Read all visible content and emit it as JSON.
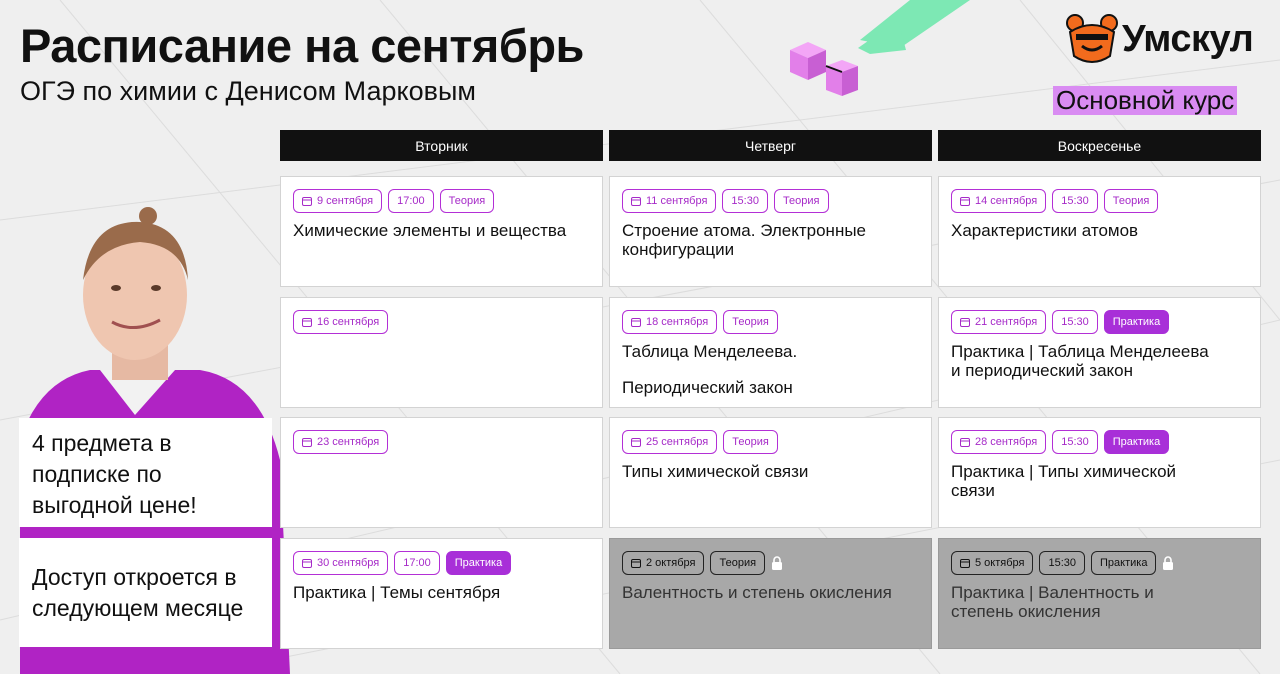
{
  "header": {
    "title": "Расписание на сентябрь",
    "subtitle": "ОГЭ по химии с Денисом Марковым"
  },
  "brand": {
    "logo_text": "Умскул",
    "course_label": "Основной курс",
    "accent": "#a82fd8",
    "highlight": "#d98cf2",
    "mascot_color": "#f26b1d"
  },
  "days": [
    "Вторник",
    "Четверг",
    "Воскресенье"
  ],
  "schedule": [
    [
      {
        "date": "9 сентября",
        "time": "17:00",
        "type": "Теория",
        "title": "Химические элементы и вещества",
        "title2": "",
        "locked": false,
        "practice": false
      },
      {
        "date": "16 сентября",
        "time": "",
        "type": "",
        "title": "",
        "title2": "",
        "locked": false,
        "practice": false
      },
      {
        "date": "23 сентября",
        "time": "",
        "type": "",
        "title": "",
        "title2": "",
        "locked": false,
        "practice": false
      },
      {
        "date": "30 сентября",
        "time": "17:00",
        "type": "Практика",
        "title": "Практика | Темы сентября",
        "title2": "",
        "locked": false,
        "practice": true
      }
    ],
    [
      {
        "date": "11 сентября",
        "time": "15:30",
        "type": "Теория",
        "title": "Строение атома. Электронные конфигурации",
        "title2": "",
        "locked": false,
        "practice": false
      },
      {
        "date": "18 сентября",
        "time": "",
        "type": "Теория",
        "title": "Таблица Менделеева.",
        "title2": "Периодический закон",
        "locked": false,
        "practice": false
      },
      {
        "date": "25 сентября",
        "time": "",
        "type": "Теория",
        "title": "Типы химической связи",
        "title2": "",
        "locked": false,
        "practice": false
      },
      {
        "date": "2 октября",
        "time": "",
        "type": "Теория",
        "title": "Валентность и степень окисления",
        "title2": "",
        "locked": true,
        "practice": false
      }
    ],
    [
      {
        "date": "14 сентября",
        "time": "15:30",
        "type": "Теория",
        "title": "Характеристики атомов",
        "title2": "",
        "locked": false,
        "practice": false
      },
      {
        "date": "21 сентября",
        "time": "15:30",
        "type": "Практика",
        "title": "Практика | Таблица Менделеева и периодический закон",
        "title2": "",
        "locked": false,
        "practice": true
      },
      {
        "date": "28 сентября",
        "time": "15:30",
        "type": "Практика",
        "title": "Практика | Типы химической связи",
        "title2": "",
        "locked": false,
        "practice": true
      },
      {
        "date": "5 октября",
        "time": "15:30",
        "type": "Практика",
        "title": "Практика | Валентность и степень окисления",
        "title2": "",
        "locked": true,
        "practice": true
      }
    ]
  ],
  "promos": {
    "subscription": "4 предмета в подписке по выгодной цене!",
    "access": "Доступ откроется в следующем месяце"
  },
  "icons": {
    "calendar": "calendar-icon",
    "lock": "lock-icon",
    "logo": "bear-mascot-icon"
  }
}
